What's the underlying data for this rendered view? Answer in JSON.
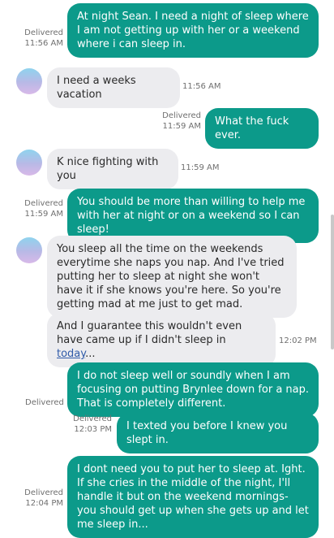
{
  "messages": [
    {
      "dir": "out",
      "text": "At night Sean. I need a night of sleep where I am not getting up with her or a weekend where i can sleep in.",
      "status": "Delivered",
      "time": "11:56 AM"
    },
    {
      "dir": "in",
      "text": "I need a weeks vacation",
      "time": "11:56 AM"
    },
    {
      "dir": "out",
      "text": "What the fuck ever.",
      "status": "Delivered",
      "time": "11:59 AM"
    },
    {
      "dir": "in",
      "text": "K nice fighting with you",
      "time": "11:59 AM"
    },
    {
      "dir": "out",
      "text": "You should be more than willing to help me with her at night or on a weekend so I can sleep!",
      "status": "Delivered",
      "time": "11:59 AM"
    },
    {
      "dir": "in",
      "text": "You sleep all the time on the weekends everytime she naps you nap. And I've tried putting her to sleep at night she won't have it if she knows you're here. So you're getting mad at me just to get mad."
    },
    {
      "dir": "in",
      "text_before": "And I guarantee this wouldn't even have came up if I didn't sleep in ",
      "link": "today",
      "text_after": "...",
      "time": "12:02 PM"
    },
    {
      "dir": "out",
      "text": "I do not sleep well or soundly when I am focusing on putting Brynlee down for a nap. That is completely different.",
      "status": "Delivered"
    },
    {
      "dir": "out",
      "text": "I texted you before I knew you slept in.",
      "status": "Delivered",
      "time": "12:03 PM"
    },
    {
      "dir": "out",
      "text": "I dont need you to put her to sleep at. Ight. If she cries in the middle of the night, I'll handle it but on the weekend mornings- you should get up when she gets up and let me sleep in...",
      "status": "Delivered",
      "time": "12:04 PM"
    }
  ],
  "colors": {
    "outgoing": "#0c9a8a",
    "incoming": "#ececef",
    "link": "#2f5aa8"
  },
  "icons": {
    "avatar": "contact-avatar"
  }
}
